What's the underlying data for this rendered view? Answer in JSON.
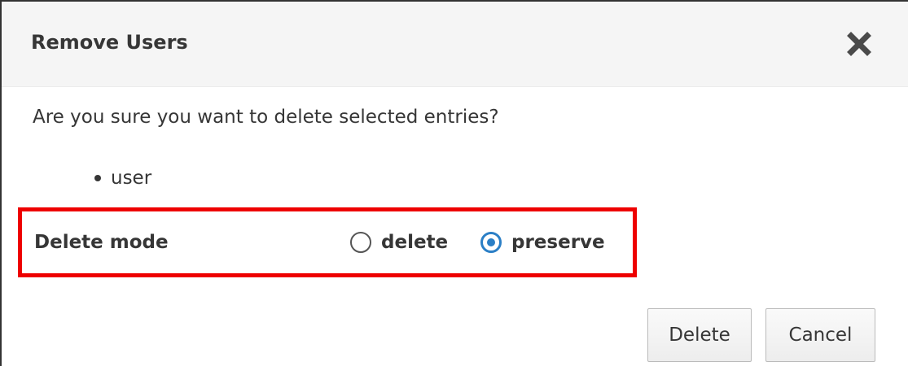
{
  "dialog": {
    "title": "Remove Users",
    "close_icon": "close-icon",
    "question": "Are you sure you want to delete selected entries?",
    "entries": [
      "user"
    ],
    "delete_mode": {
      "label": "Delete mode",
      "options": [
        {
          "label": "delete",
          "selected": false
        },
        {
          "label": "preserve",
          "selected": true
        }
      ]
    },
    "buttons": {
      "delete_label": "Delete",
      "cancel_label": "Cancel"
    }
  },
  "colors": {
    "header_bg": "#f5f5f5",
    "radio_accent": "#2b7fc6",
    "highlight": "#ee0000",
    "text": "#363636"
  }
}
